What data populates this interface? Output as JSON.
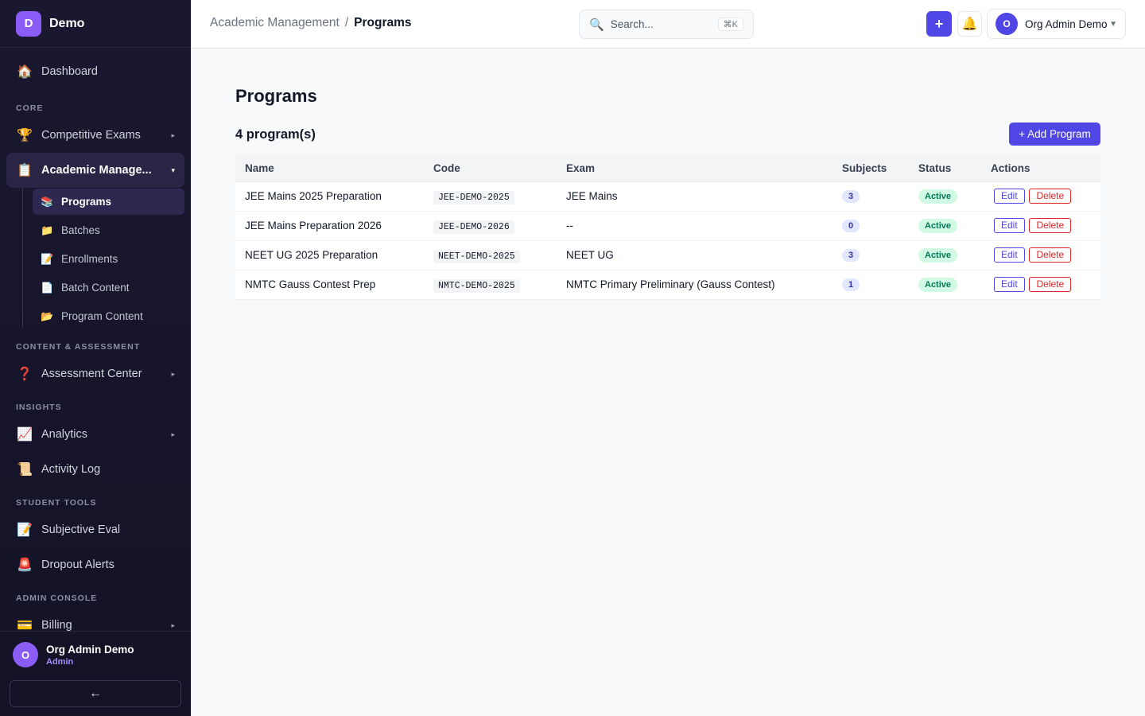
{
  "brand": {
    "initial": "D",
    "name": "Demo"
  },
  "sidebar": {
    "items": [
      {
        "id": "dashboard",
        "icon": "🏠",
        "label": "Dashboard"
      },
      {
        "id": "competitive-exams",
        "icon": "🏆",
        "label": "Competitive Exams",
        "caret": "▸"
      },
      {
        "id": "academic-management",
        "icon": "📋",
        "label": "Academic Manage...",
        "caret": "▾"
      },
      {
        "id": "assessment-center",
        "icon": "❓",
        "label": "Assessment Center",
        "caret": "▸"
      },
      {
        "id": "analytics",
        "icon": "📈",
        "label": "Analytics",
        "caret": "▸"
      },
      {
        "id": "activity-log",
        "icon": "📜",
        "label": "Activity Log"
      },
      {
        "id": "subjective-eval",
        "icon": "📝",
        "label": "Subjective Eval"
      },
      {
        "id": "dropout-alerts",
        "icon": "🚨",
        "label": "Dropout Alerts"
      },
      {
        "id": "billing",
        "icon": "💳",
        "label": "Billing",
        "caret": "▸"
      }
    ],
    "sections": [
      "CORE",
      "CONTENT & ASSESSMENT",
      "INSIGHTS",
      "STUDENT TOOLS",
      "ADMIN CONSOLE"
    ],
    "subitems": [
      {
        "icon": "📚",
        "label": "Programs"
      },
      {
        "icon": "📁",
        "label": "Batches"
      },
      {
        "icon": "📝",
        "label": "Enrollments"
      },
      {
        "icon": "📄",
        "label": "Batch Content"
      },
      {
        "icon": "📂",
        "label": "Program Content"
      }
    ],
    "user": {
      "initial": "O",
      "name": "Org Admin Demo",
      "role": "Admin"
    },
    "collapse_icon": "←"
  },
  "header": {
    "breadcrumb": {
      "parent": "Academic Management",
      "separator": "/",
      "current": "Programs"
    },
    "search": {
      "icon": "🔍",
      "placeholder": "Search...",
      "shortcut": "⌘K"
    },
    "plus_icon": "+",
    "bell_icon": "🔔",
    "profile": {
      "initial": "O",
      "name": "Org Admin Demo",
      "dropdown_icon": "▼"
    }
  },
  "main": {
    "title": "Programs",
    "count_label": "4 program(s)",
    "add_button": "+ Add Program",
    "columns": [
      "Name",
      "Code",
      "Exam",
      "Subjects",
      "Status",
      "Actions"
    ],
    "rows": [
      {
        "name": "JEE Mains 2025 Preparation",
        "code": "JEE-DEMO-2025",
        "exam": "JEE Mains",
        "subjects": "3",
        "status": "Active"
      },
      {
        "name": "JEE Mains Preparation 2026",
        "code": "JEE-DEMO-2026",
        "exam": "--",
        "subjects": "0",
        "status": "Active"
      },
      {
        "name": "NEET UG 2025 Preparation",
        "code": "NEET-DEMO-2025",
        "exam": "NEET UG",
        "subjects": "3",
        "status": "Active"
      },
      {
        "name": "NMTC Gauss Contest Prep",
        "code": "NMTC-DEMO-2025",
        "exam": "NMTC Primary Preliminary (Gauss Contest)",
        "subjects": "1",
        "status": "Active"
      }
    ],
    "edit_label": "Edit",
    "delete_label": "Delete"
  },
  "colors": {
    "accent": "#4f46e5",
    "brand": "#8b5cf6",
    "sidebar_bg": "#1a1830",
    "success": "#047857",
    "danger": "#dc2626"
  }
}
